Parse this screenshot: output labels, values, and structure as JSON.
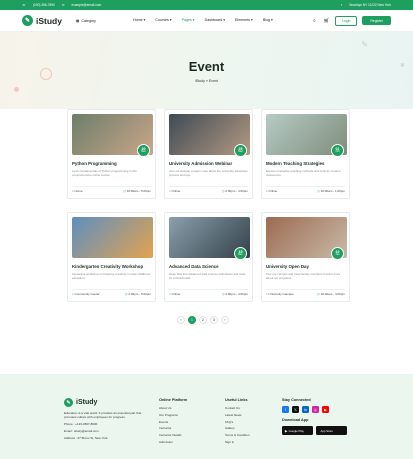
{
  "topbar": {
    "phone": "(000) 356-7890",
    "email": "example@email.com",
    "address": "Brooklyn NY 11222 New York"
  },
  "nav": {
    "logo": "iStudy",
    "category": "Category",
    "menu": [
      "Home",
      "Courses",
      "Pages",
      "Dashboard",
      "Elements",
      "Blog"
    ],
    "active_index": 2,
    "cart_count": "0",
    "login": "Login",
    "register": "Register"
  },
  "hero": {
    "title": "Event",
    "crumb_home": "iStudy",
    "crumb_sep": "»",
    "crumb_current": "Event"
  },
  "events": [
    {
      "title": "Python Programming",
      "desc": "Learn fundamentals of Python programming in this comprehensive online course.",
      "day": "20",
      "month": "Dec",
      "location": "Home",
      "time": "10:00am - 5:00pm",
      "colors": [
        "#6d7e6a",
        "#caa68a"
      ]
    },
    {
      "title": "University Admission Webinar",
      "desc": "Join our webinar to learn more about the university admission process and tips.",
      "day": "25",
      "month": "Mar",
      "location": "Online",
      "time": "2:00pm - 4:00pm",
      "colors": [
        "#3f4a55",
        "#b49a82"
      ]
    },
    {
      "title": "Modern Teaching Strategies",
      "desc": "Explore innovative teaching methods and tools for modern classrooms.",
      "day": "01",
      "month": "Oct",
      "location": "Online",
      "time": "10:00am - 1:00pm",
      "colors": [
        "#b6cbc6",
        "#7f8d7a"
      ]
    },
    {
      "title": "Kindergarten Creativity Workshop",
      "desc": "Interactive workshop on fostering creativity in early childhood education.",
      "day": "",
      "month": "",
      "location": "Community Center",
      "time": "2:00pm - 5:00pm",
      "colors": [
        "#5e8fbf",
        "#e2a34f"
      ]
    },
    {
      "title": "Advanced Data Science",
      "desc": "Deep dive into advanced data science techniques and tools for professionals.",
      "day": "15",
      "month": "Dec",
      "location": "Online",
      "time": "2:00pm - 4:00pm",
      "colors": [
        "#8aa0ad",
        "#334048"
      ]
    },
    {
      "title": "University Open Day",
      "desc": "Tour our campus and meet faculty members to learn more about our programs.",
      "day": "22",
      "month": "Jun",
      "location": "University Campus",
      "time": "10:00am - 4:00pm",
      "colors": [
        "#9c6b52",
        "#c9b9a6"
      ]
    }
  ],
  "pagination": [
    "‹",
    "1",
    "2",
    "3",
    "›"
  ],
  "pagination_active": 1,
  "footer": {
    "logo": "iStudy",
    "about": "Education is a vital world. It provides an essential part that promotes culture with employees for progress.",
    "phone": "Phone : +123-4567-8900",
    "email": "Email : istudy@email.com",
    "address": "Address : 27 Bronx St, New York",
    "online_platform": {
      "heading": "Online Platform",
      "links": [
        "About Us",
        "Our Programs",
        "Events",
        "Instructor",
        "Instructor Details",
        "Admission"
      ]
    },
    "useful_links": {
      "heading": "Useful Links",
      "links": [
        "Contact Us",
        "Latest News",
        "FAQ's",
        "Gallery",
        "Terms & Condition",
        "Sign in"
      ]
    },
    "stay_connected": "Stay Connected",
    "social": [
      {
        "icon": "facebook-icon",
        "glyph": "f",
        "color": "#1877f2"
      },
      {
        "icon": "twitter-icon",
        "glyph": "𝕏",
        "color": "#111111"
      },
      {
        "icon": "linkedin-icon",
        "glyph": "in",
        "color": "#0a66c2"
      },
      {
        "icon": "instagram-icon",
        "glyph": "◎",
        "color": "#d6249f"
      },
      {
        "icon": "youtube-icon",
        "glyph": "▶",
        "color": "#ff0000"
      }
    ],
    "download_app": "Download App",
    "google_play": "Google Play",
    "app_store": "App Store"
  }
}
